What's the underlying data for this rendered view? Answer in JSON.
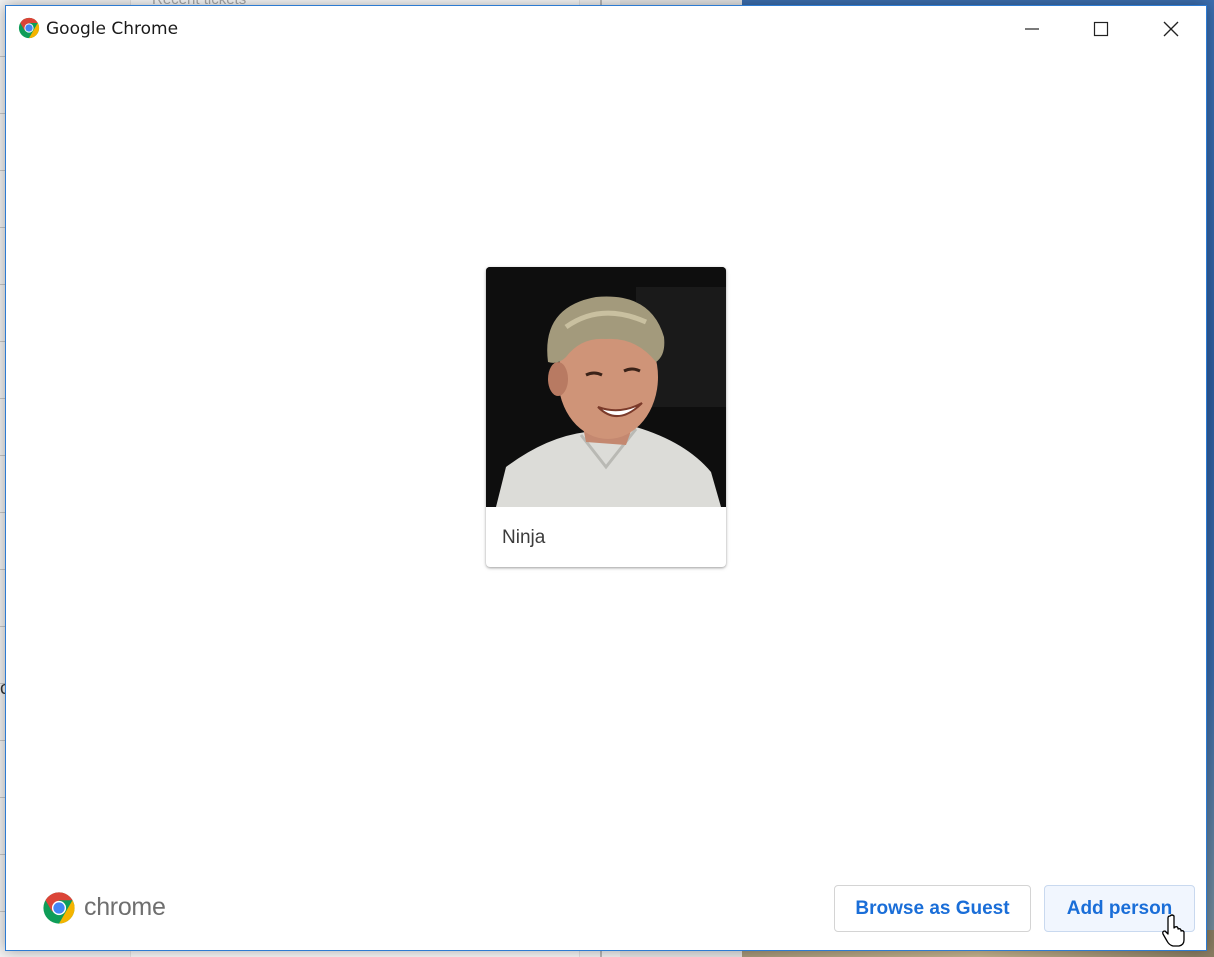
{
  "background": {
    "recent_tickets_label": "Recent tickets",
    "stray_char": "c"
  },
  "window": {
    "title": "Google Chrome",
    "app_icon": "chrome-icon",
    "controls": {
      "minimize_icon": "minimize-icon",
      "maximize_icon": "maximize-icon",
      "close_icon": "close-icon"
    }
  },
  "profiles": [
    {
      "name": "Ninja",
      "avatar": "user-photo"
    }
  ],
  "footer": {
    "logo_icon": "chrome-logo-icon",
    "brand_wordmark": "chrome",
    "browse_as_guest_label": "Browse as Guest",
    "add_person_label": "Add person"
  },
  "colors": {
    "accent": "#1a6ed8",
    "window_border": "#2d7bd2",
    "chrome_red": "#db4437",
    "chrome_green": "#0f9d58",
    "chrome_yellow": "#f4b400",
    "chrome_blue": "#4285f4"
  }
}
